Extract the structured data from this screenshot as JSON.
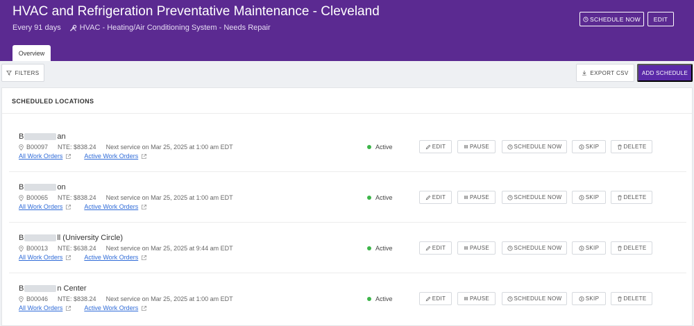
{
  "header": {
    "title": "HVAC and Refrigeration Preventative Maintenance - Cleveland",
    "frequency": "Every 91 days",
    "asset": "HVAC - Heating/Air Conditioning System - Needs Repair",
    "schedule_now_label": "SCHEDULE NOW",
    "edit_label": "EDIT",
    "tab_label": "Overview"
  },
  "toolbar": {
    "filters_label": "FILTERS",
    "export_label": "EXPORT CSV",
    "add_label": "ADD SCHEDULE"
  },
  "section": {
    "title": "SCHEDULED LOCATIONS"
  },
  "rows": [
    {
      "name_prefix": "B",
      "name_suffix": "an",
      "code": "B00097",
      "nte": "NTE: $838.24",
      "vendor": "",
      "next_service": "Next service on Mar 25, 2025 at 1:00 am EDT",
      "all_work_orders": "All Work Orders",
      "active_work_orders": "Active Work Orders",
      "status": "Active"
    },
    {
      "name_prefix": "B",
      "name_suffix": "on",
      "code": "B00065",
      "nte": "NTE: $838.24",
      "vendor": "",
      "next_service": "Next service on Mar 25, 2025 at 1:00 am EDT",
      "all_work_orders": "All Work Orders",
      "active_work_orders": "Active Work Orders",
      "status": "Active"
    },
    {
      "name_prefix": "B",
      "name_suffix": "ll (University Circle)",
      "code": "B00013",
      "nte": "NTE: $638.24",
      "vendor": "",
      "next_service": "Next service on Mar 25, 2025 at 9:44 am EDT",
      "all_work_orders": "All Work Orders",
      "active_work_orders": "Active Work Orders",
      "status": "Active"
    },
    {
      "name_prefix": "B",
      "name_suffix": "n Center",
      "code": "B00046",
      "nte": "NTE: $838.24",
      "vendor": "",
      "next_service": "Next service on Mar 25, 2025 at 1:00 am EDT",
      "all_work_orders": "All Work Orders",
      "active_work_orders": "Active Work Orders",
      "status": "Active"
    }
  ],
  "actions": {
    "edit": "EDIT",
    "pause": "PAUSE",
    "schedule_now": "SCHEDULE NOW",
    "skip": "SKIP",
    "delete": "DELETE"
  },
  "icons": {
    "wrench": "wrench-icon",
    "filter": "filter-icon",
    "download": "download-icon",
    "pin": "location-pin-icon",
    "external": "external-link-icon",
    "pencil": "pencil-icon",
    "pause": "pause-icon",
    "clock": "clock-icon",
    "skip": "skip-icon",
    "trash": "trash-icon"
  },
  "colors": {
    "brand": "#5b2a91",
    "primary_button": "#5b2aa8",
    "active_status": "#3db54a",
    "link": "#2f6bd8"
  }
}
